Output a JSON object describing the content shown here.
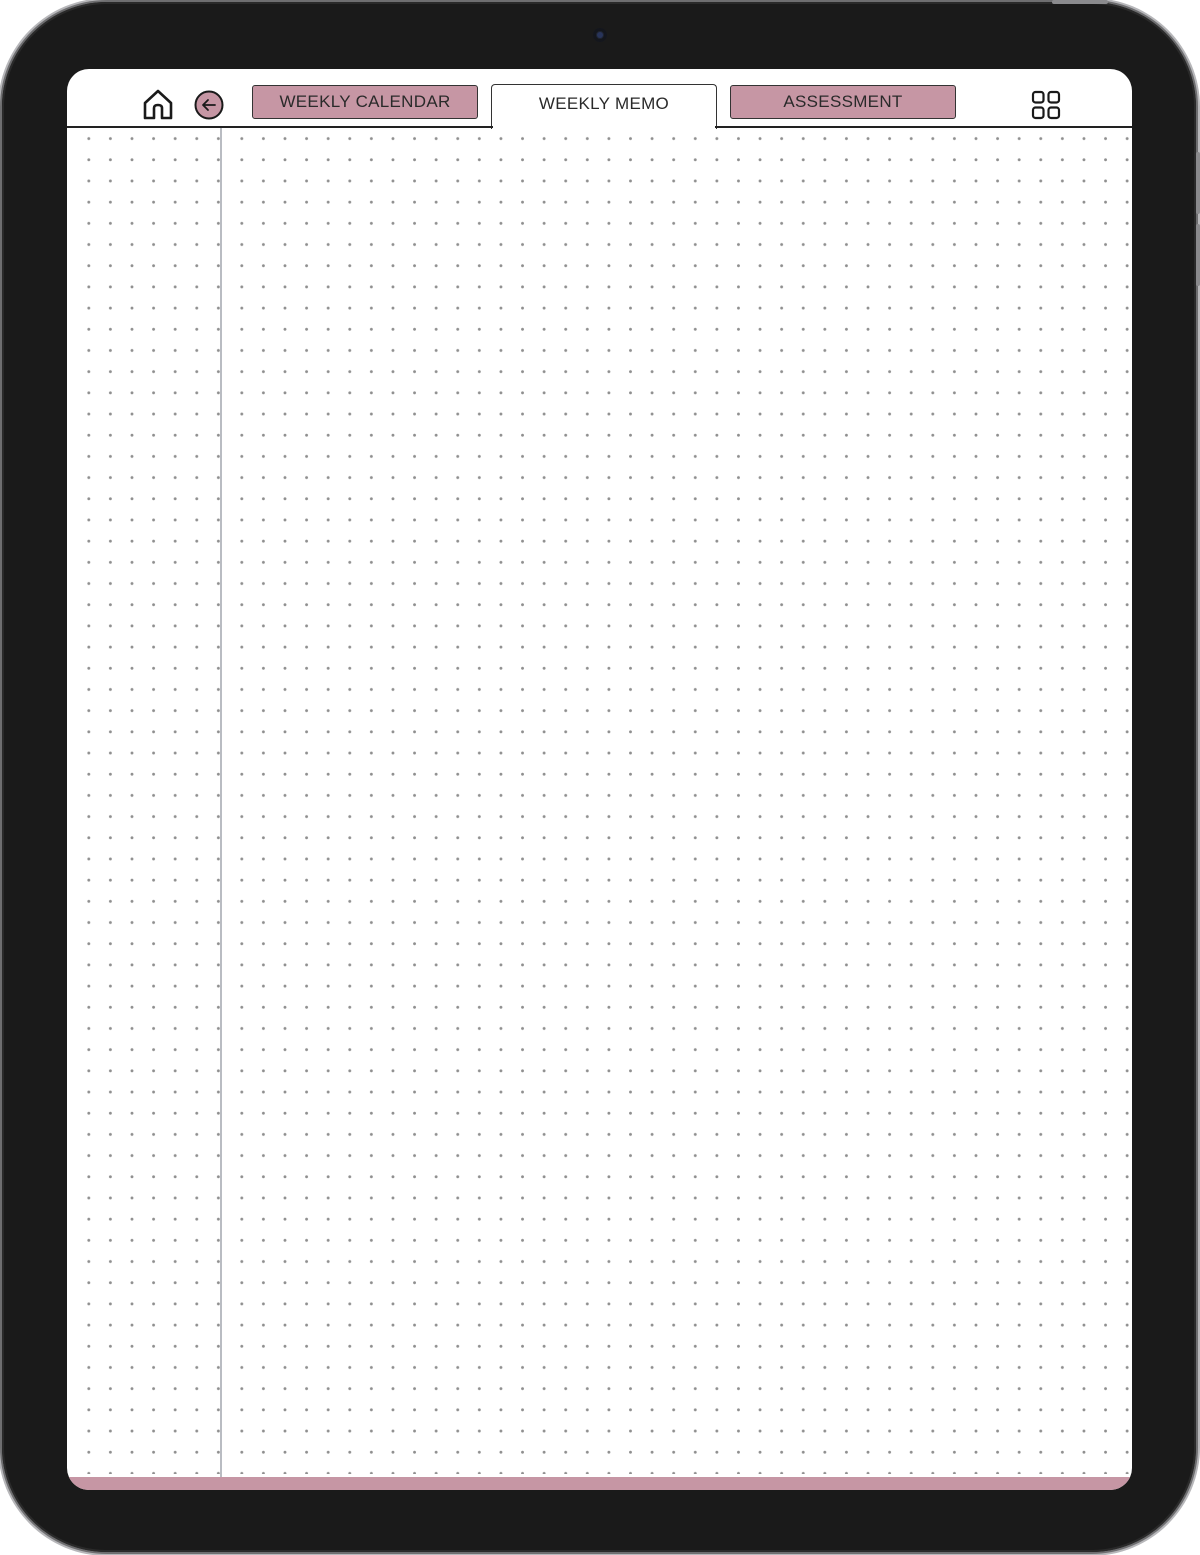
{
  "nav": {
    "home_icon": "home-icon",
    "back_icon": "arrow-left-circle-icon",
    "grid_icon": "grid-menu-icon"
  },
  "tabs": [
    {
      "label": "WEEKLY CALENDAR",
      "active": false
    },
    {
      "label": "WEEKLY MEMO",
      "active": true
    },
    {
      "label": "ASSESSMENT",
      "active": false
    }
  ],
  "colors": {
    "accent": "#c696a4",
    "device_frame": "#1a1a1a",
    "dot": "#8f8f8f",
    "divider": "#b9bcc2"
  }
}
